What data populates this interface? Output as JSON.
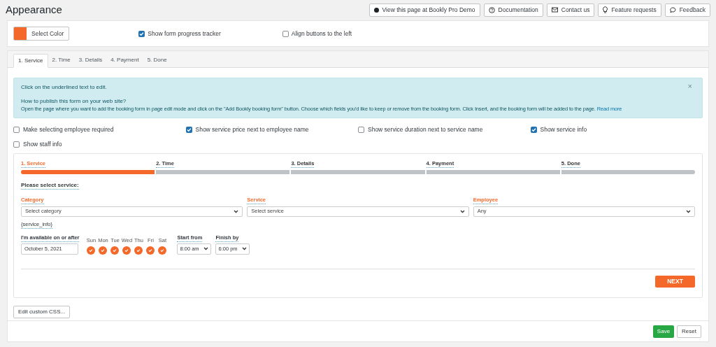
{
  "page_title": "Appearance",
  "header_buttons": [
    {
      "kind": "dot",
      "label": "View this page at Bookly Pro Demo"
    },
    {
      "kind": "help",
      "label": "Documentation"
    },
    {
      "kind": "mail",
      "label": "Contact us"
    },
    {
      "kind": "bulb",
      "label": "Feature requests"
    },
    {
      "kind": "chat",
      "label": "Feedback"
    }
  ],
  "color_picker": {
    "color": "#f4692a",
    "label": "Select Color"
  },
  "top_options": [
    {
      "label": "Show form progress tracker",
      "checked": true
    },
    {
      "label": "Align buttons to the left",
      "checked": false
    }
  ],
  "tabs": [
    {
      "label": "1. Service",
      "selected": true
    },
    {
      "label": "2. Time",
      "selected": false
    },
    {
      "label": "3. Details",
      "selected": false
    },
    {
      "label": "4. Payment",
      "selected": false
    },
    {
      "label": "5. Done",
      "selected": false
    }
  ],
  "notice": {
    "line_1": "Click on the underlined text to edit.",
    "line_2": "How to publish this form on your web site?",
    "line_3": "Open the page where you want to add the booking form in page edit mode and click on the \"Add Bookly booking form\" button. Choose which fields you'd like to keep or remove from the booking form. Click Insert, and the booking form will be added to the page.",
    "link": "Read more",
    "close": "×"
  },
  "options": [
    {
      "label": "Make selecting employee required",
      "checked": false
    },
    {
      "label": "Show service price next to employee name",
      "checked": true
    },
    {
      "label": "Show service duration next to service name",
      "checked": false
    },
    {
      "label": "Show service info",
      "checked": true
    },
    {
      "label": "Show staff info",
      "checked": false
    }
  ],
  "form": {
    "steps": [
      {
        "label": "1. Service",
        "active": true
      },
      {
        "label": "2. Time",
        "active": false
      },
      {
        "label": "3. Details",
        "active": false
      },
      {
        "label": "4. Payment",
        "active": false
      },
      {
        "label": "5. Done",
        "active": false
      }
    ],
    "heading": "Please select service:",
    "selects": [
      {
        "label": "Category",
        "value": "Select category"
      },
      {
        "label": "Service",
        "value": "Select service"
      },
      {
        "label": "Employee",
        "value": "Any"
      }
    ],
    "service_info": "{service_info}",
    "date_label": "I'm available on or after",
    "date_value": "October 5, 2021",
    "days": [
      {
        "label": "Sun",
        "checked": true
      },
      {
        "label": "Mon",
        "checked": true
      },
      {
        "label": "Tue",
        "checked": true
      },
      {
        "label": "Wed",
        "checked": true
      },
      {
        "label": "Thu",
        "checked": true
      },
      {
        "label": "Fri",
        "checked": true
      },
      {
        "label": "Sat",
        "checked": true
      }
    ],
    "start_label": "Start from",
    "start_value": "8:00 am",
    "finish_label": "Finish by",
    "finish_value": "6:00 pm",
    "next_button": "NEXT"
  },
  "custom_css_button": "Edit custom CSS...",
  "footer_buttons": [
    {
      "kind": "primary",
      "label": "Save"
    },
    {
      "kind": "default",
      "label": "Reset"
    }
  ]
}
